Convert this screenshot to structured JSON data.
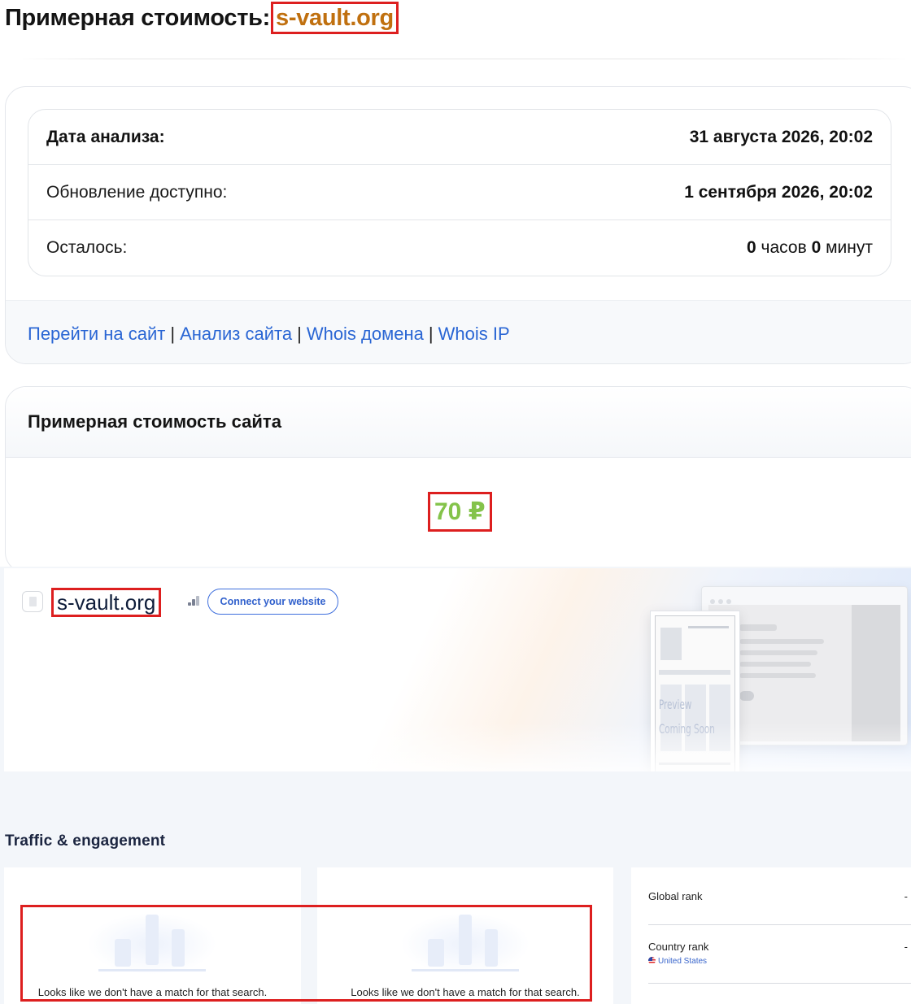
{
  "header": {
    "title_prefix": "Примерная стоимость:",
    "domain": "s-vault.org"
  },
  "info": {
    "rows": [
      {
        "label": "Дата анализа:",
        "value": "31 августа 2026, 20:02"
      },
      {
        "label": "Обновление доступно:",
        "value": "1 сентября 2026, 20:02"
      }
    ],
    "remaining": {
      "label": "Осталось:",
      "hours": "0",
      "hours_unit": "часов",
      "minutes": "0",
      "minutes_unit": "минут"
    },
    "links": {
      "goto_site": "Перейти на сайт",
      "site_analysis": "Анализ сайта",
      "whois_domain": "Whois домена",
      "whois_ip": "Whois IP",
      "separator": "|"
    }
  },
  "valuation": {
    "heading": "Примерная стоимость сайта",
    "amount": "70 ₽",
    "amount_color": "#84c34a"
  },
  "widget": {
    "domain": "s-vault.org",
    "connect_button": "Connect your website",
    "preview_line1": "Preview",
    "preview_line2": "Coming Soon",
    "traffic_title": "Traffic & engagement",
    "empty_message_1": "Looks like we don't have a match for that search.",
    "empty_message_2": "Looks like we don't have a match for that search.",
    "global_rank_label": "Global rank",
    "global_rank_value": "-",
    "country_rank_label": "Country rank",
    "country_rank_value": "-",
    "country_name": "United States"
  },
  "colors": {
    "highlight_border": "#dd1f1f",
    "title_domain": "#c0700f",
    "link": "#2a66d4",
    "connect_button": "#2f5fcc"
  },
  "icons": [
    "favicon-placeholder-icon",
    "signal-bars-icon",
    "us-flag-icon"
  ]
}
